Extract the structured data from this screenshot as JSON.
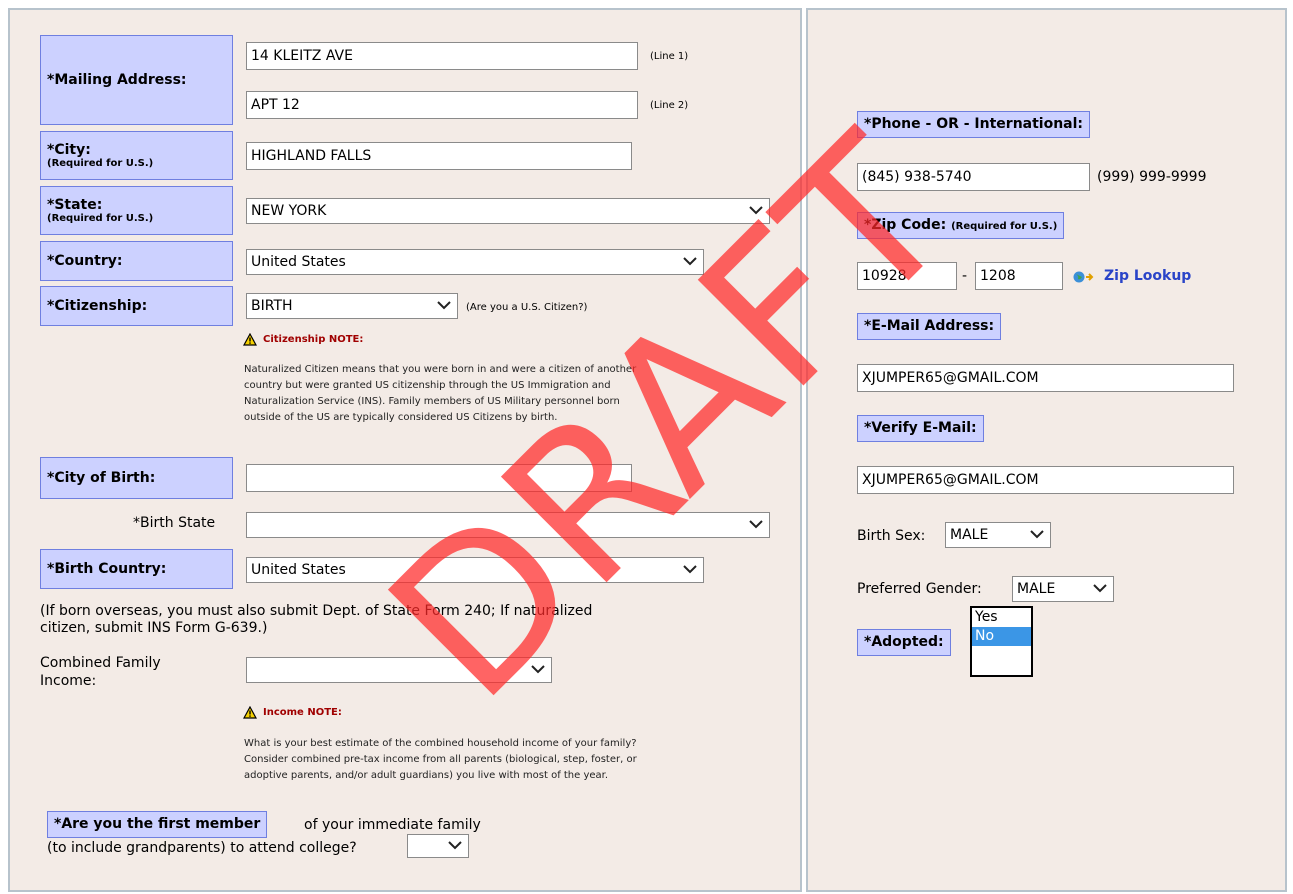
{
  "left": {
    "mailing": {
      "label": "*Mailing Address:",
      "line1_value": "14 KLEITZ AVE",
      "line1_hint": "(Line 1)",
      "line2_value": "APT 12",
      "line2_hint": "(Line 2)"
    },
    "city": {
      "label": "*City:",
      "sub": "(Required for U.S.)",
      "value": "HIGHLAND FALLS"
    },
    "state": {
      "label": "*State:",
      "sub": "(Required for U.S.)",
      "value": "NEW YORK"
    },
    "country": {
      "label": "*Country:",
      "value": "United States"
    },
    "citizenship": {
      "label": "*Citizenship:",
      "value": "BIRTH",
      "hint": "(Are you a U.S. Citizen?)",
      "note_title": "Citizenship NOTE:",
      "note_lines": [
        "Naturalized Citizen means that you were born in and were a citizen of another",
        "country but were granted US citizenship through the US Immigration and",
        "Naturalization Service (INS). Family members of US Military personnel born",
        "outside of the US are typically considered US Citizens by birth."
      ]
    },
    "city_of_birth": {
      "label": "*City of Birth:",
      "value": ""
    },
    "birth_state": {
      "label": "*Birth State",
      "value": ""
    },
    "birth_country": {
      "label": "*Birth Country:",
      "value": "United States",
      "note_line1": "(If born overseas, you must also submit Dept. of State Form 240; If naturalized",
      "note_line2": "citizen, submit INS Form G-639.)"
    },
    "income": {
      "label_line1": "Combined Family",
      "label_line2": "Income:",
      "value": "",
      "note_title": "Income NOTE:",
      "note_lines": [
        "What is your best estimate of the combined household income of your family?",
        "Consider combined pre-tax income from all parents (biological, step, foster, or",
        "adoptive parents, and/or adult guardians) you live with most of the year."
      ]
    },
    "first_member": {
      "label": "*Are you the first member",
      "text_after": "of your immediate family",
      "text_line2": "(to include grandparents) to attend college?",
      "value": ""
    }
  },
  "right": {
    "phone": {
      "label": "*Phone - OR - International:",
      "value": "(845) 938-5740",
      "format_hint": "(999) 999-9999"
    },
    "zip": {
      "label": "*Zip Code:",
      "sub": "(Required for U.S.)",
      "zip5": "10928",
      "dash": "-",
      "zip4": "1208",
      "lookup": "Zip Lookup"
    },
    "email": {
      "label": "*E-Mail Address:",
      "value": "XJUMPER65@GMAIL.COM"
    },
    "verify_email": {
      "label": "*Verify E-Mail:",
      "value": "XJUMPER65@GMAIL.COM"
    },
    "birth_sex": {
      "label": "Birth Sex:",
      "value": "MALE"
    },
    "preferred_gender": {
      "label": "Preferred Gender:",
      "value": "MALE"
    },
    "adopted": {
      "label": "*Adopted:",
      "options": [
        "Yes",
        "No"
      ],
      "selected": "No"
    }
  },
  "watermark": "DRAFT",
  "colors": {
    "label_bg": "#ccd1ff",
    "panel_bg": "#f3ebe6",
    "watermark": "#ff2828",
    "note_title": "#a00000",
    "list_selected": "#3b96e6"
  }
}
